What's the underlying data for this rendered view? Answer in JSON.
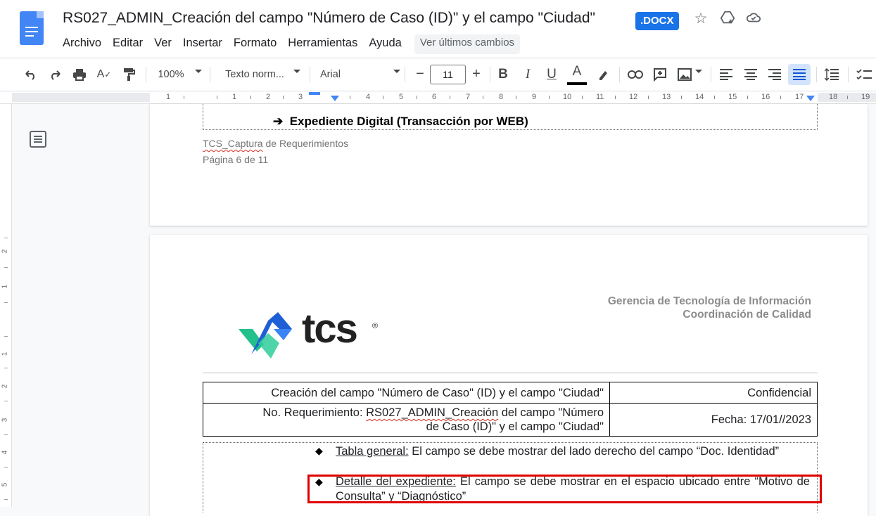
{
  "app": {
    "title": "RS027_ADMIN_Creación del campo \"Número de Caso (ID)\" y el campo \"Ciudad\"",
    "badge": ".DOCX",
    "menu": [
      "Archivo",
      "Editar",
      "Ver",
      "Insertar",
      "Formato",
      "Herramientas",
      "Ayuda"
    ],
    "last_edit": "Ver últimos cambios"
  },
  "toolbar": {
    "zoom": "100%",
    "style": "Texto norm...",
    "font": "Arial",
    "font_size": "11",
    "minus": "−",
    "plus": "+",
    "bold": "B",
    "italic": "I",
    "underline": "U",
    "text_color": "A"
  },
  "ruler": {
    "ticks": [
      "1",
      "1",
      "2",
      "3",
      "4",
      "5",
      "6",
      "7",
      "8",
      "9",
      "10",
      "11",
      "12",
      "13",
      "14",
      "15",
      "16",
      "17",
      "18",
      "19",
      "20"
    ]
  },
  "vertical_ruler": [
    "2",
    "1",
    "1",
    "2",
    "3",
    "4",
    "5"
  ],
  "page6": {
    "heading_arrow": "➔",
    "heading": "Expediente Digital (Transacción por WEB)",
    "footer_tcs": "TCS_Captura",
    "footer_rest": " de Requerimientos",
    "footer_page": "Página 6 de 11"
  },
  "page7": {
    "header_line1": "Gerencia de Tecnología de Información",
    "header_line2": "Coordinación de Calidad",
    "logo_text": "tcs",
    "logo_reg": "®",
    "table": {
      "r1c1": "Creación del campo \"Número de Caso\" (ID) y el campo \"Ciudad\"",
      "r1c2": "Confidencial",
      "r2c1_prefix": "No. Requerimiento: ",
      "r2c1_code": "RS027_ADMIN_Creación",
      "r2c1_rest_a": " del campo \"Número",
      "r2c1_rest_b": "de Caso (ID)\" y el campo \"Ciudad\"",
      "r2c2": "Fecha: 17/01//2023"
    },
    "bullet_symbol": "◆",
    "bullets": [
      {
        "label": "Tabla general:",
        "text": " El campo se debe mostrar del lado derecho del campo “Doc. Identidad”"
      },
      {
        "label": "Detalle del expediente:",
        "text": " El campo se debe mostrar  en el espacio ubicado entre “Motivo de Consulta” y “Diagnóstico”"
      }
    ]
  },
  "colors": {
    "accent": "#1a73e8",
    "highlight_border": "#e00000",
    "logo_green": "#22c08a",
    "logo_blue": "#1f5fd6"
  }
}
